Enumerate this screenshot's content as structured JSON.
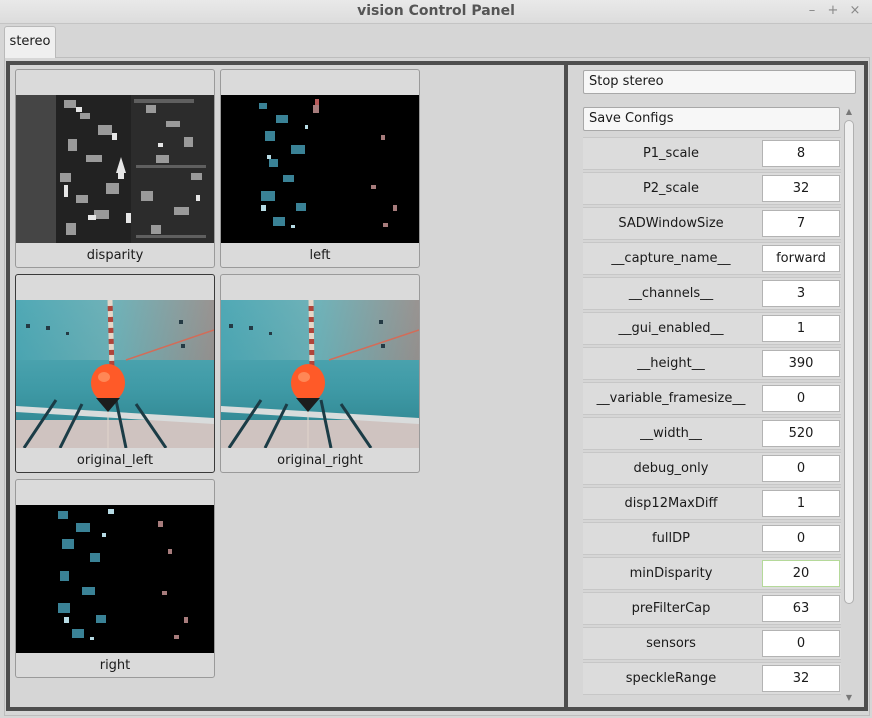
{
  "window": {
    "title": "vision Control Panel",
    "minimize_glyph": "–",
    "maximize_glyph": "+",
    "close_glyph": "×"
  },
  "tabs": [
    {
      "label": "stereo"
    }
  ],
  "images": [
    {
      "caption": "disparity",
      "kind": "disparity"
    },
    {
      "caption": "left",
      "kind": "sparse"
    },
    {
      "caption": "original_left",
      "kind": "pool"
    },
    {
      "caption": "original_right",
      "kind": "pool"
    },
    {
      "caption": "right",
      "kind": "sparse"
    }
  ],
  "controls": {
    "stop_label": "Stop stereo",
    "save_label": "Save Configs"
  },
  "params": [
    {
      "name": "P1_scale",
      "value": "8"
    },
    {
      "name": "P2_scale",
      "value": "32"
    },
    {
      "name": "SADWindowSize",
      "value": "7"
    },
    {
      "name": "__capture_name__",
      "value": "forward"
    },
    {
      "name": "__channels__",
      "value": "3"
    },
    {
      "name": "__gui_enabled__",
      "value": "1"
    },
    {
      "name": "__height__",
      "value": "390"
    },
    {
      "name": "__variable_framesize__",
      "value": "0"
    },
    {
      "name": "__width__",
      "value": "520"
    },
    {
      "name": "debug_only",
      "value": "0"
    },
    {
      "name": "disp12MaxDiff",
      "value": "1"
    },
    {
      "name": "fullDP",
      "value": "0"
    },
    {
      "name": "minDisparity",
      "value": "20"
    },
    {
      "name": "preFilterCap",
      "value": "63"
    },
    {
      "name": "sensors",
      "value": "0"
    },
    {
      "name": "speckleRange",
      "value": "32"
    }
  ],
  "focused_param": "minDisparity",
  "colors": {
    "panel_border": "#4e4e4e",
    "background": "#d6d6d6",
    "buoy": "#ff5a28",
    "pool": "#3f9aa6"
  }
}
